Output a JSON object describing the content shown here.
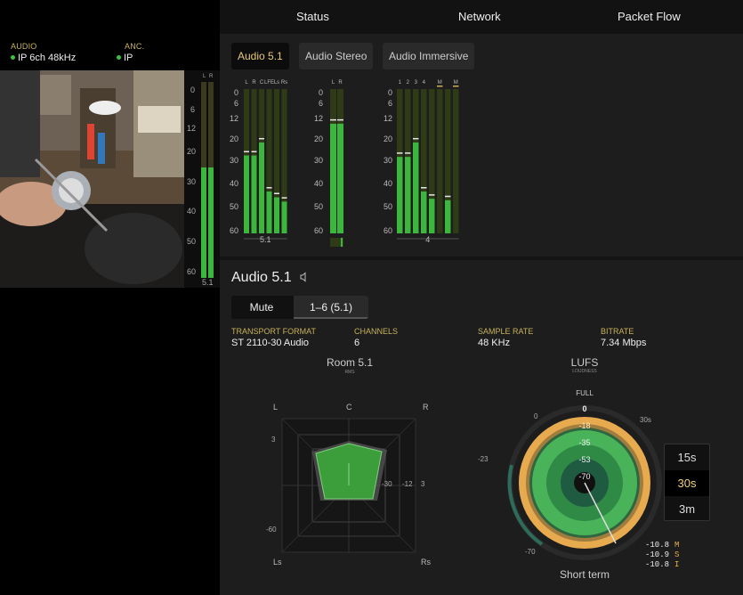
{
  "nav": {
    "tabs": [
      "Status",
      "Network",
      "Packet Flow"
    ]
  },
  "left": {
    "audio_label": "AUDIO",
    "audio_value": "IP 6ch 48kHz",
    "anc_label": "ANC.",
    "anc_value": "IP",
    "meter": {
      "channels": [
        "L",
        "R"
      ],
      "scale": [
        "0",
        "6",
        "12",
        "20",
        "30",
        "40",
        "50",
        "60"
      ],
      "format": "5.1",
      "levels": [
        0.565,
        0.565
      ]
    }
  },
  "audio_tabs": [
    "Audio 5.1",
    "Audio Stereo",
    "Audio Immersive"
  ],
  "active_audio_tab": 0,
  "meters": {
    "scale": [
      "0",
      "6",
      "12",
      "20",
      "30",
      "40",
      "50",
      "60"
    ],
    "group51": {
      "channels": [
        "L",
        "R",
        "C",
        "LFE",
        "Ls",
        "Rs"
      ],
      "levels": [
        0.54,
        0.54,
        0.63,
        0.29,
        0.25,
        0.22
      ],
      "footer": "5.1"
    },
    "stereo": {
      "channels": [
        "L",
        "R"
      ],
      "levels": [
        0.76,
        0.76
      ]
    },
    "immersive": {
      "channels": [
        "1",
        "2",
        "3",
        "4",
        "",
        "M",
        "",
        "M"
      ],
      "levels": [
        0.53,
        0.53,
        0.63,
        0.29,
        0.24,
        0.0,
        0.23,
        0.0
      ],
      "footer": "4"
    }
  },
  "detail": {
    "title": "Audio 5.1",
    "mute_label": "Mute",
    "channel_label": "1–6 (5.1)",
    "fields": [
      {
        "label": "TRANSPORT FORMAT",
        "value": "ST 2110-30 Audio"
      },
      {
        "label": "CHANNELS",
        "value": "6"
      },
      {
        "label": "SAMPLE RATE",
        "value": "48 KHz"
      },
      {
        "label": "BITRATE",
        "value": "7.34 Mbps"
      }
    ]
  },
  "room": {
    "title": "Room 5.1",
    "subtitle": "RMS",
    "axes": {
      "l": "L",
      "c": "C",
      "r": "R",
      "ls": "Ls",
      "rs": "Rs"
    },
    "scale": {
      "s3": "3",
      "s60": "-60",
      "s30": "-30",
      "s12": "-12",
      "s3b": "3"
    }
  },
  "lufs": {
    "title": "LUFS",
    "subtitle": "LOUDNESS",
    "full_label": "FULL",
    "ring_labels": [
      "0",
      "-18",
      "-35",
      "-53",
      "-70"
    ],
    "outer_labels": {
      "zero": "0",
      "thirty": "30s",
      "minus23": "-23",
      "minus70": "-70"
    },
    "footer": "Short term",
    "time_options": [
      "15s",
      "30s",
      "3m"
    ],
    "active_time": 1,
    "readouts": [
      {
        "value": "-10.8",
        "key": "M"
      },
      {
        "value": "-10.9",
        "key": "S"
      },
      {
        "value": "-10.8",
        "key": "I"
      }
    ]
  },
  "colors": {
    "accent": "#c8b15a",
    "meter_green": "#3cb63c",
    "lufs_orange": "#e6b14a"
  }
}
